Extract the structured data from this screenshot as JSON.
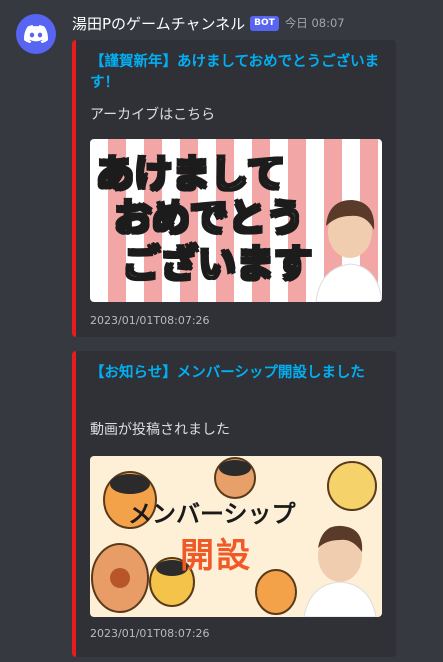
{
  "author": {
    "name": "湯田Pのゲームチャンネル",
    "badge": "BOT",
    "timestamp": "今日 08:07",
    "avatar_icon": "discord-logo-icon"
  },
  "embeds": [
    {
      "title": "【謹賀新年】あけましておめでとうございます！",
      "description": "アーカイブはこちら",
      "thumbnail_lines": [
        "あけまして",
        "おめでとう",
        "ございます"
      ],
      "footer": "2023/01/01T08:07:26",
      "accent": "#e81c1c"
    },
    {
      "title": "【お知らせ】メンバーシップ開設しました",
      "description": "動画が投稿されました",
      "thumbnail_lines": [
        "メンバーシップ",
        "開設"
      ],
      "footer": "2023/01/01T08:07:26",
      "accent": "#e81c1c"
    }
  ],
  "colors": {
    "background": "#36393f",
    "embed_bg": "#2f3136",
    "link": "#00aff4",
    "bot_badge": "#5865f2"
  }
}
